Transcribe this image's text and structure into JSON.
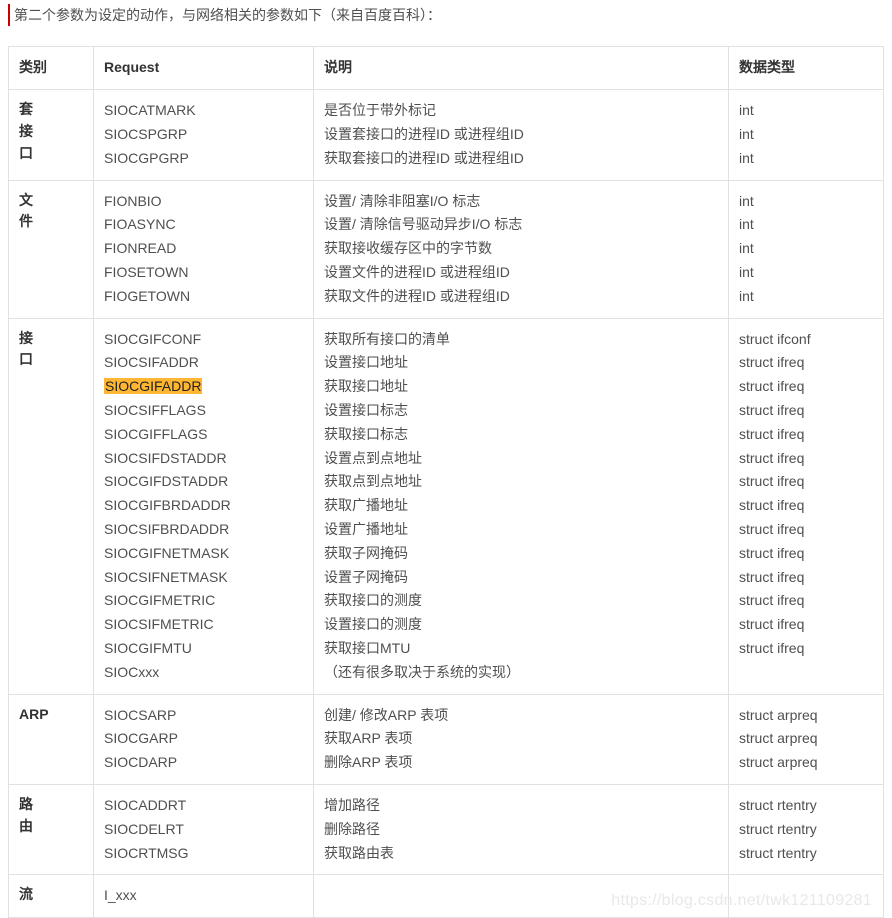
{
  "intro": "第二个参数为设定的动作，与网络相关的参数如下（来自百度百科）：",
  "headers": {
    "category": "类别",
    "request": "Request",
    "desc": "说明",
    "type": "数据类型"
  },
  "sections": [
    {
      "category": "套接口",
      "rows": [
        {
          "request": "SIOCATMARK",
          "desc": "是否位于带外标记",
          "type": "int",
          "highlight": false
        },
        {
          "request": "SIOCSPGRP",
          "desc": "设置套接口的进程ID 或进程组ID",
          "type": "int",
          "highlight": false
        },
        {
          "request": "SIOCGPGRP",
          "desc": "获取套接口的进程ID 或进程组ID",
          "type": "int",
          "highlight": false
        }
      ]
    },
    {
      "category": "文件",
      "rows": [
        {
          "request": "FIONBIO",
          "desc": "设置/ 清除非阻塞I/O 标志",
          "type": "int",
          "highlight": false
        },
        {
          "request": "FIOASYNC",
          "desc": "设置/ 清除信号驱动异步I/O 标志",
          "type": "int",
          "highlight": false
        },
        {
          "request": "FIONREAD",
          "desc": "获取接收缓存区中的字节数",
          "type": "int",
          "highlight": false
        },
        {
          "request": "FIOSETOWN",
          "desc": "设置文件的进程ID 或进程组ID",
          "type": "int",
          "highlight": false
        },
        {
          "request": "FIOGETOWN",
          "desc": "获取文件的进程ID 或进程组ID",
          "type": "int",
          "highlight": false
        }
      ]
    },
    {
      "category": "接口",
      "rows": [
        {
          "request": "SIOCGIFCONF",
          "desc": "获取所有接口的清单",
          "type": "struct ifconf",
          "highlight": false
        },
        {
          "request": "SIOCSIFADDR",
          "desc": "设置接口地址",
          "type": "struct ifreq",
          "highlight": false
        },
        {
          "request": "SIOCGIFADDR",
          "desc": "获取接口地址",
          "type": "struct ifreq",
          "highlight": true
        },
        {
          "request": "SIOCSIFFLAGS",
          "desc": "设置接口标志",
          "type": "struct ifreq",
          "highlight": false
        },
        {
          "request": "SIOCGIFFLAGS",
          "desc": "获取接口标志",
          "type": "struct ifreq",
          "highlight": false
        },
        {
          "request": "SIOCSIFDSTADDR",
          "desc": "设置点到点地址",
          "type": "struct ifreq",
          "highlight": false
        },
        {
          "request": "SIOCGIFDSTADDR",
          "desc": "获取点到点地址",
          "type": "struct ifreq",
          "highlight": false
        },
        {
          "request": "SIOCGIFBRDADDR",
          "desc": "获取广播地址",
          "type": "struct ifreq",
          "highlight": false
        },
        {
          "request": "SIOCSIFBRDADDR",
          "desc": "设置广播地址",
          "type": "struct ifreq",
          "highlight": false
        },
        {
          "request": "SIOCGIFNETMASK",
          "desc": "获取子网掩码",
          "type": "struct ifreq",
          "highlight": false
        },
        {
          "request": "SIOCSIFNETMASK",
          "desc": "设置子网掩码",
          "type": "struct ifreq",
          "highlight": false
        },
        {
          "request": "SIOCGIFMETRIC",
          "desc": "获取接口的测度",
          "type": "struct ifreq",
          "highlight": false
        },
        {
          "request": "SIOCSIFMETRIC",
          "desc": "设置接口的测度",
          "type": "struct ifreq",
          "highlight": false
        },
        {
          "request": "SIOCGIFMTU",
          "desc": "获取接口MTU",
          "type": "struct ifreq",
          "highlight": false
        },
        {
          "request": "SIOCxxx",
          "desc": "（还有很多取决于系统的实现）",
          "type": "",
          "highlight": false
        }
      ]
    },
    {
      "category": "ARP",
      "rows": [
        {
          "request": "SIOCSARP",
          "desc": "创建/ 修改ARP 表项",
          "type": "struct arpreq",
          "highlight": false
        },
        {
          "request": "SIOCGARP",
          "desc": "获取ARP 表项",
          "type": "struct arpreq",
          "highlight": false
        },
        {
          "request": "SIOCDARP",
          "desc": "删除ARP 表项",
          "type": "struct arpreq",
          "highlight": false
        }
      ]
    },
    {
      "category": "路由",
      "rows": [
        {
          "request": "SIOCADDRT",
          "desc": "增加路径",
          "type": "struct rtentry",
          "highlight": false
        },
        {
          "request": "SIOCDELRT",
          "desc": "删除路径",
          "type": "struct rtentry",
          "highlight": false
        },
        {
          "request": "SIOCRTMSG",
          "desc": "获取路由表",
          "type": "struct rtentry",
          "highlight": false
        }
      ]
    },
    {
      "category": "流",
      "rows": [
        {
          "request": "I_xxx",
          "desc": "",
          "type": "",
          "highlight": false
        }
      ]
    }
  ],
  "watermark": "https://blog.csdn.net/twk121109281"
}
